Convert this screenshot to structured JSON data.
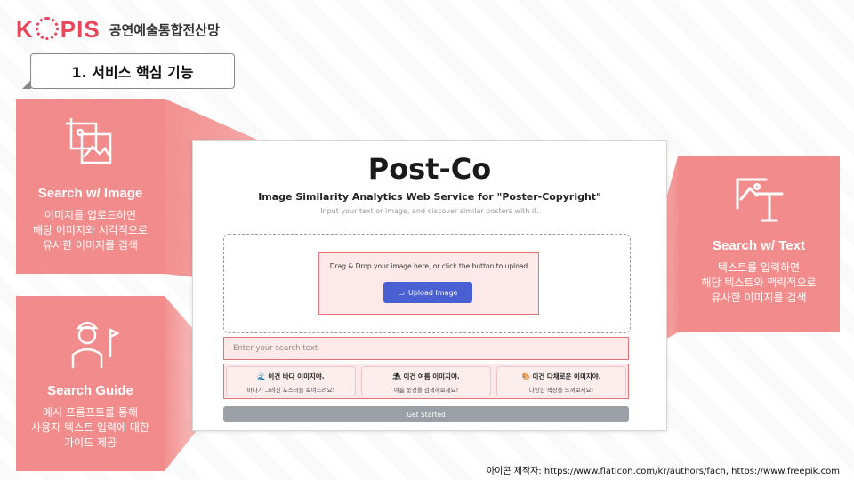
{
  "header": {
    "logo_text": "KOPIS",
    "logo_sub": "공연예술통합전산망",
    "section_title": "1. 서비스 핵심 기능"
  },
  "colors": {
    "accent": "#f28b8b",
    "brand": "#e8475b",
    "button_blue": "#4a5fd1",
    "button_gray": "#9aa0a6"
  },
  "panels": {
    "image": {
      "icon": "image-frame-icon",
      "title": "Search w/ Image",
      "desc_lines": [
        "이미지를 업로드하면",
        "해당 이미지와 시각적으로",
        "유사한 이미지를 검색"
      ]
    },
    "guide": {
      "icon": "golfer-icon",
      "title": "Search Guide",
      "desc_lines": [
        "예시 프롬프트를 통해",
        "사용자 텍스트 입력에 대한",
        "가이드 제공"
      ]
    },
    "text": {
      "icon": "image-text-icon",
      "title": "Search w/ Text",
      "desc_lines": [
        "텍스트를 입력하면",
        "해당 텍스트와 맥락적으로",
        "유사한 이미지를 검색"
      ]
    }
  },
  "app": {
    "title": "Post-Co",
    "subtitle": "Image Similarity Analytics Web Service for \"Poster-Copyright\"",
    "hint": "Input your text or image, and discover similar posters with it.",
    "drop_text": "Drag & Drop your image here, or click the button to upload",
    "upload_label": "Upload Image",
    "search_placeholder": "Enter your search text",
    "guides": [
      {
        "emoji": "🌊",
        "title": "이건 바다 이미지야.",
        "desc": "바다가 그려진 포스터를 보여드려요!"
      },
      {
        "emoji": "⛱",
        "title": "이건 여름 이미지야.",
        "desc": "여름 풍경을 검색해보세요!"
      },
      {
        "emoji": "🎨",
        "title": "이건 다채로운 이미지야.",
        "desc": "다양한 색상을 느껴보세요!"
      }
    ],
    "start_label": "Get Started"
  },
  "credit": "아이콘 제작자: https://www.flaticon.com/kr/authors/fach, https://www.freepik.com"
}
